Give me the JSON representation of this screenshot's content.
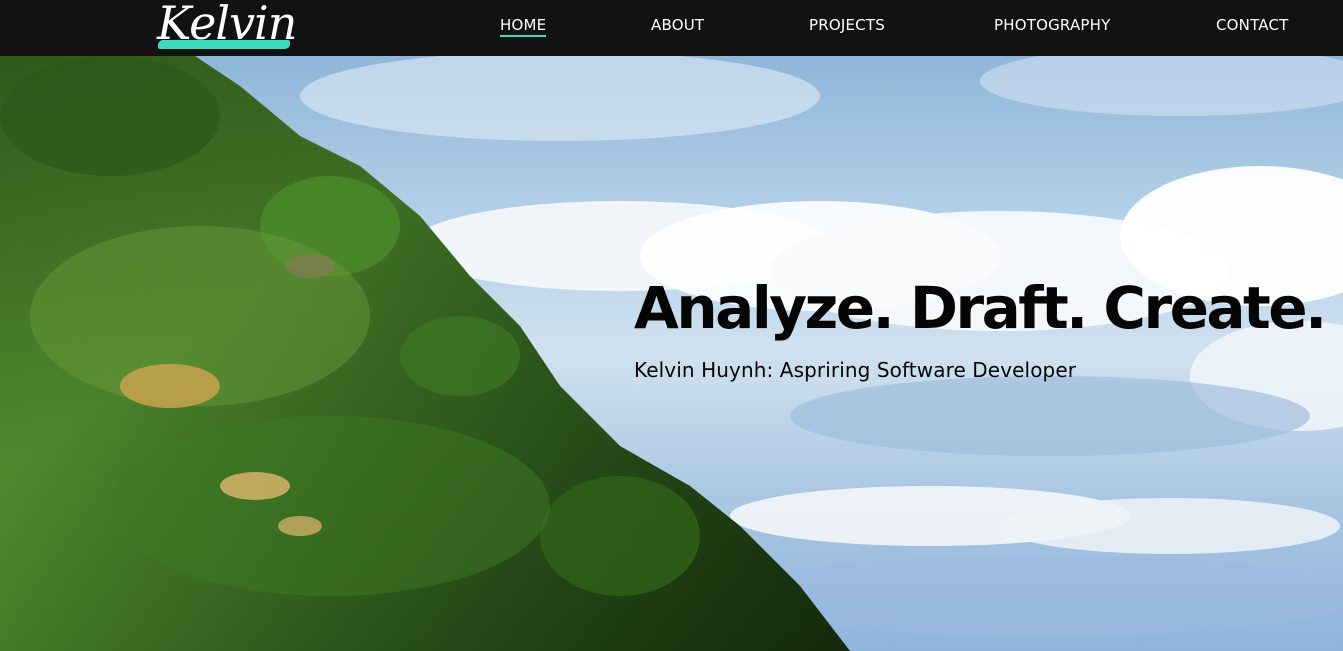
{
  "nav": {
    "logo_text": "Kelvin",
    "links": [
      {
        "label": "HOME",
        "active": true
      },
      {
        "label": "ABOUT",
        "active": false
      },
      {
        "label": "PROJECTS",
        "active": false
      },
      {
        "label": "PHOTOGRAPHY",
        "active": false
      },
      {
        "label": "CONTACT",
        "active": false
      }
    ]
  },
  "hero": {
    "title": "Analyze. Draft. Create.",
    "subtitle": "Kelvin Huynh: Aspriring Software Developer"
  },
  "colors": {
    "navbar_bg": "#121212",
    "accent": "#3ddbb9",
    "nav_text": "#ffffff",
    "hero_text": "#050505"
  }
}
